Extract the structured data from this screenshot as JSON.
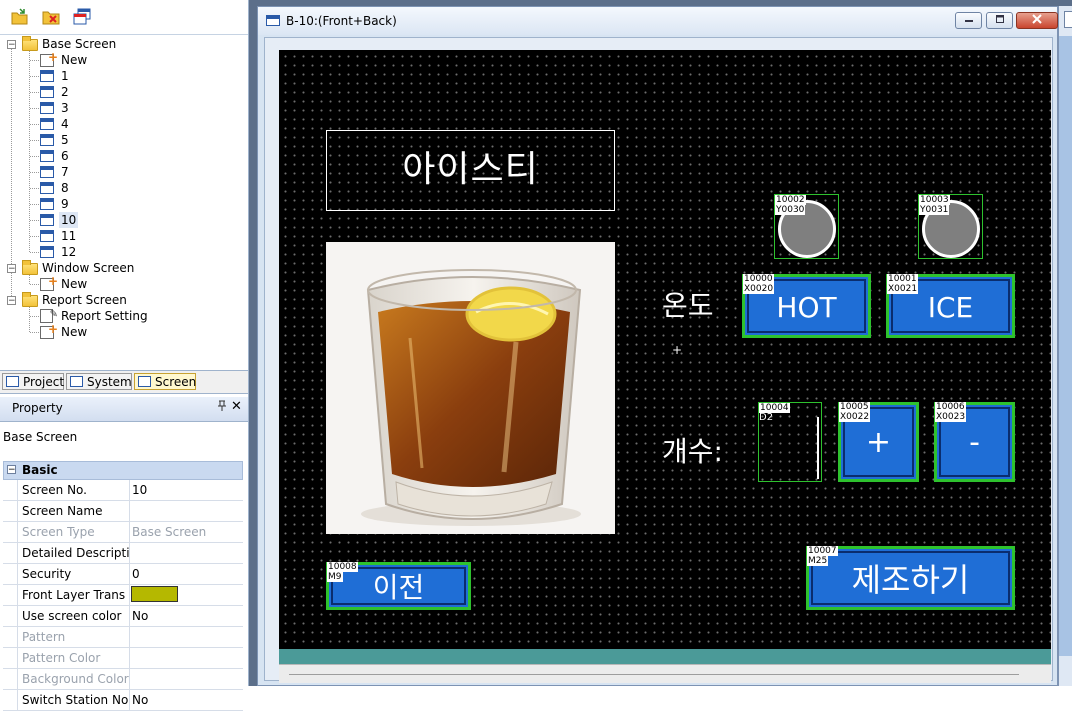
{
  "toolbar": {
    "icons": [
      "open-folder-icon",
      "delete-screen-icon",
      "window-copy-icon"
    ]
  },
  "tree": {
    "base_screen": "Base Screen",
    "base_items": [
      "New",
      "1",
      "2",
      "3",
      "4",
      "5",
      "6",
      "7",
      "8",
      "9",
      "10",
      "11",
      "12"
    ],
    "selected": "10",
    "window_screen": "Window Screen",
    "window_items": [
      "New"
    ],
    "report_screen": "Report Screen",
    "report_items": [
      "Report Setting",
      "New"
    ]
  },
  "tabs": [
    {
      "label": "Project"
    },
    {
      "label": "System"
    },
    {
      "label": "Screen",
      "active": true
    }
  ],
  "property": {
    "title": "Property",
    "pin": "ᵖ",
    "close": "✕",
    "object": "Base Screen",
    "category": "Basic",
    "rows": [
      {
        "key": "Screen No.",
        "value": "10",
        "disabled": false
      },
      {
        "key": "Screen Name",
        "value": "",
        "disabled": false
      },
      {
        "key": "Screen Type",
        "value": "Base Screen",
        "disabled": true
      },
      {
        "key": "Detailed Descriptio",
        "value": "",
        "disabled": false
      },
      {
        "key": "Security",
        "value": "0",
        "disabled": false
      },
      {
        "key": "Front Layer Trans",
        "value": "",
        "disabled": false,
        "swatch": "#b5b800"
      },
      {
        "key": "Use screen color",
        "value": "No",
        "disabled": false
      },
      {
        "key": "Pattern",
        "value": "",
        "disabled": true
      },
      {
        "key": "Pattern Color",
        "value": "",
        "disabled": true
      },
      {
        "key": "Background Color",
        "value": "",
        "disabled": true
      },
      {
        "key": "Switch Station No",
        "value": "No",
        "disabled": false
      }
    ]
  },
  "window": {
    "title": "B-10:(Front+Back)",
    "buttons": [
      "minimize-button",
      "restore-button",
      "close-button"
    ]
  },
  "canvas": {
    "title_text": "아이스티",
    "label_temp": "온도",
    "label_count": "개수:",
    "lamps": [
      {
        "id": "10002",
        "addr": "Y0030"
      },
      {
        "id": "10003",
        "addr": "Y0031"
      }
    ],
    "hot": {
      "id": "10000",
      "addr": "X0020",
      "label": "HOT"
    },
    "ice": {
      "id": "10001",
      "addr": "X0021",
      "label": "ICE"
    },
    "numeric": {
      "id": "10004",
      "addr": "D2"
    },
    "plus": {
      "id": "10005",
      "addr": "X0022",
      "label": "+"
    },
    "minus": {
      "id": "10006",
      "addr": "X0023",
      "label": "-"
    },
    "prev": {
      "id": "10008",
      "addr": "M9",
      "label": "이전"
    },
    "make": {
      "id": "10007",
      "addr": "M25",
      "label": "제조하기"
    },
    "cursor": "+"
  },
  "colors": {
    "button_blue": "#1f6ed6",
    "frame_green": "#2ec22e",
    "lamp_gray": "#7f7f7f",
    "canvas_black": "#000000",
    "teal_bar": "#4b9a98"
  }
}
